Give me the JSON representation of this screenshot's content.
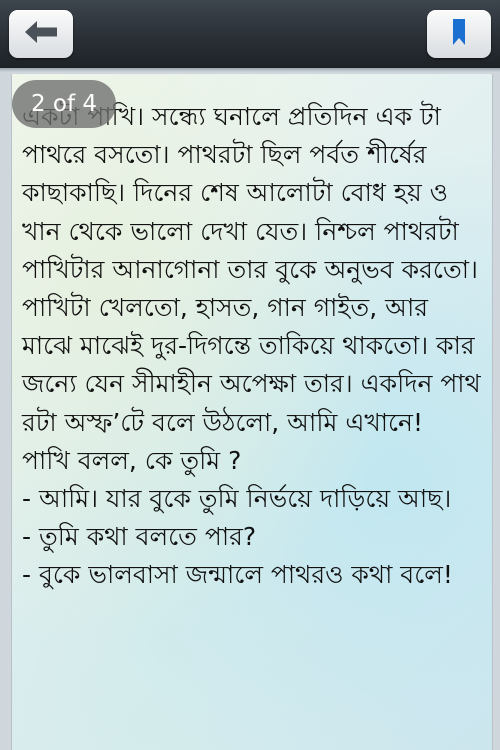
{
  "toolbar": {
    "back_icon": "back-arrow-icon",
    "bookmark_icon": "bookmark-icon"
  },
  "reader": {
    "page_indicator": "2 of 4",
    "story_text": "একটা পাখি। সন্ধ্যে ঘনালে প্রতিদিন এক টা পাথরে বসতো। পাথরটা ছিল পর্বত শীর্ষের কাছাকাছি। দিনের শেষ আলোটা বোধ হয় ওখান থেকে ভালো দেখা যেত। নিশ্চল পাথরটা পাখিটার আনাগোনা তার বুকে অনুভব করতো। পাখিটা খেলতো, হাসত, গান গাইত, আর মাঝে মাঝেই দুর-দিগন্তে তাকিয়ে থাকতো। কার জন্যে যেন সীমাহীন অপেক্ষা তার। একদিন পাথরটা অস্ফ’টে বলে উঠলো, আমি এখানে!\nপাখি বলল, কে তুমি ?\n- আমি। যার বুকে তুমি নির্ভয়ে দাড়িয়ে আছ।\n- তুমি কথা বলতে পার?\n- বুকে ভালবাসা জন্মালে পাথরও কথা বলে!"
  },
  "colors": {
    "navbar": "#2a3036",
    "button": "#eef0f2",
    "icon": "#4a5158",
    "bookmark": "#1a6fd0",
    "badge": "#6e6e6e"
  }
}
